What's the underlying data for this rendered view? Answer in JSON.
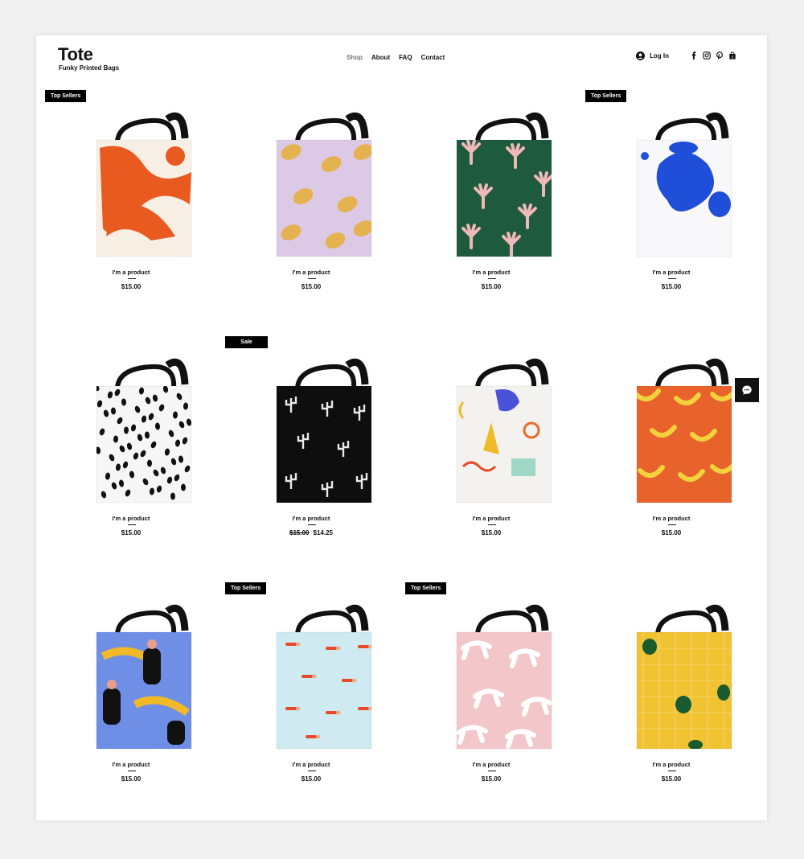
{
  "brand": {
    "title": "Tote",
    "subtitle": "Funky Printed Bags"
  },
  "nav": {
    "items": [
      "Shop",
      "About",
      "FAQ",
      "Contact"
    ],
    "active": "Shop"
  },
  "header": {
    "login_label": "Log In",
    "social_icons": [
      "facebook-icon",
      "instagram-icon",
      "pinterest-icon"
    ],
    "cart_icon": "shopping-bag-icon"
  },
  "products": [
    {
      "name": "I'm a product",
      "price": "$15.00",
      "badge": "Top Sellers",
      "pattern": "orange-abstract",
      "bg": "#f7efe4",
      "accent": "#e85a1f"
    },
    {
      "name": "I'm a product",
      "price": "$15.00",
      "badge": "",
      "pattern": "lemons",
      "bg": "#dcc9e6",
      "accent": "#e4b24e"
    },
    {
      "name": "I'm a product",
      "price": "$15.00",
      "badge": "",
      "pattern": "green-hands",
      "bg": "#1d5a3e",
      "accent": "#f0b8b8"
    },
    {
      "name": "I'm a product",
      "price": "$15.00",
      "badge": "Top Sellers",
      "pattern": "blue-blobs",
      "bg": "#f8f8fa",
      "accent": "#1f4fd8"
    },
    {
      "name": "I'm a product",
      "price": "$15.00",
      "badge": "",
      "pattern": "black-dots",
      "bg": "#f6f6f6",
      "accent": "#111111"
    },
    {
      "name": "I'm a product",
      "price": "$14.25",
      "old_price": "$15.00",
      "badge": "Sale",
      "pattern": "cactus",
      "bg": "#0e0e0e",
      "accent": "#e9e9e9"
    },
    {
      "name": "I'm a product",
      "price": "$15.00",
      "badge": "",
      "pattern": "memphis",
      "bg": "#f4f2ef",
      "accent": "#4a53d8"
    },
    {
      "name": "I'm a product",
      "price": "$15.00",
      "badge": "",
      "pattern": "bananas",
      "bg": "#e8632c",
      "accent": "#f4d23c"
    },
    {
      "name": "I'm a product",
      "price": "$15.00",
      "badge": "",
      "pattern": "women-tigers",
      "bg": "#6f8fe6",
      "accent": "#f0b928"
    },
    {
      "name": "I'm a product",
      "price": "$15.00",
      "badge": "Top Sellers",
      "pattern": "swimmers",
      "bg": "#cfeaf0",
      "accent": "#e84a2a"
    },
    {
      "name": "I'm a product",
      "price": "$15.00",
      "badge": "Top Sellers",
      "pattern": "leopards",
      "bg": "#f3c7c9",
      "accent": "#ffffff"
    },
    {
      "name": "I'm a product",
      "price": "$15.00",
      "badge": "",
      "pattern": "monstera",
      "bg": "#f1c232",
      "accent": "#1a5a2f"
    }
  ],
  "chat": {
    "icon": "chat-icon"
  }
}
